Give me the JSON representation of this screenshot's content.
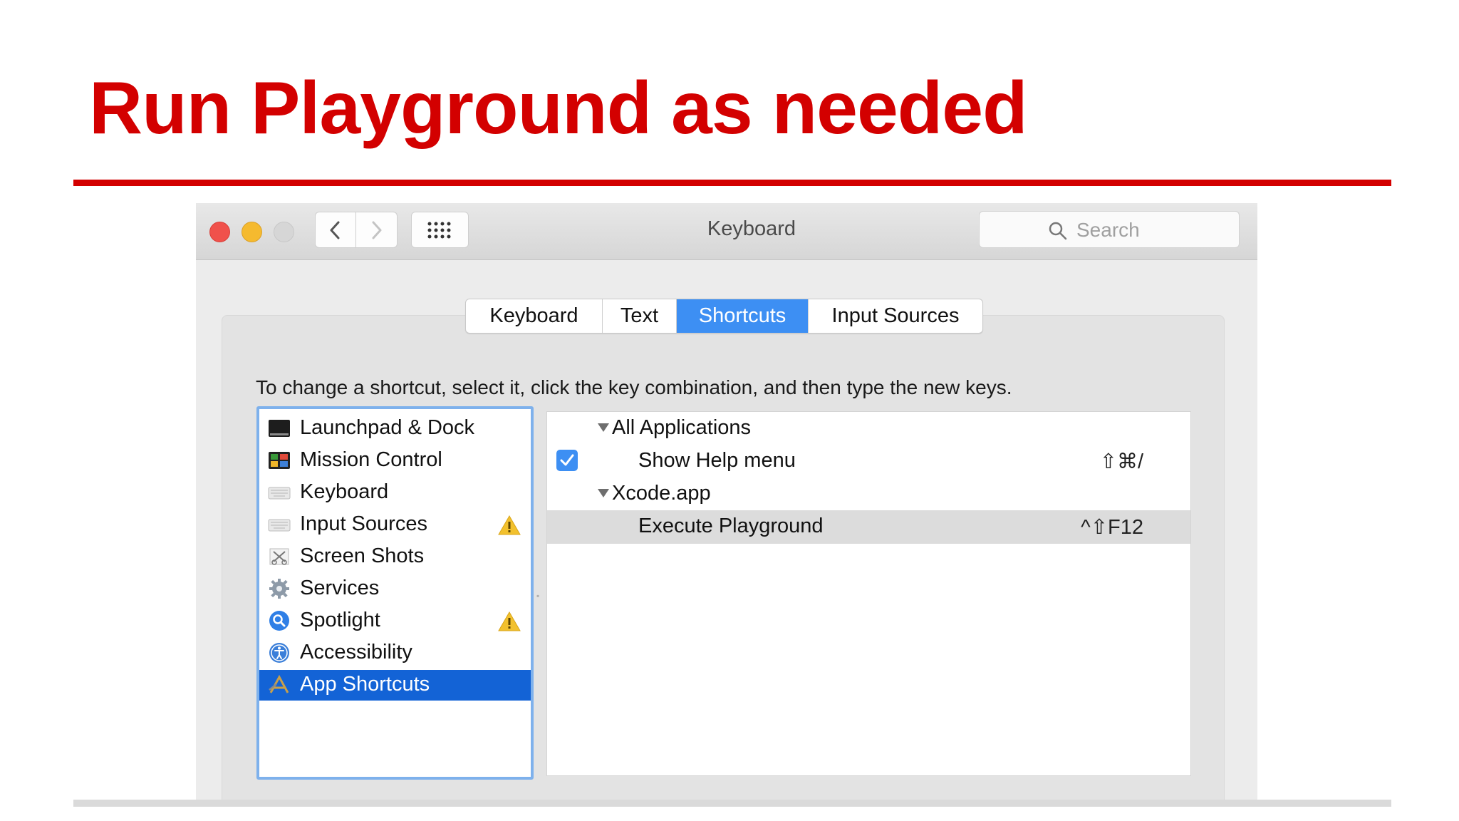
{
  "slide": {
    "title": "Run Playground as needed"
  },
  "window": {
    "title": "Keyboard",
    "search_placeholder": "Search"
  },
  "tabs": [
    {
      "label": "Keyboard",
      "active": false
    },
    {
      "label": "Text",
      "active": false
    },
    {
      "label": "Shortcuts",
      "active": true
    },
    {
      "label": "Input Sources",
      "active": false
    }
  ],
  "instruction": "To change a shortcut, select it, click the key combination, and then type the new keys.",
  "categories": [
    {
      "label": "Launchpad & Dock",
      "icon": "launchpad-dock-icon",
      "warning": false,
      "selected": false
    },
    {
      "label": "Mission Control",
      "icon": "mission-control-icon",
      "warning": false,
      "selected": false
    },
    {
      "label": "Keyboard",
      "icon": "keyboard-icon",
      "warning": false,
      "selected": false
    },
    {
      "label": "Input Sources",
      "icon": "input-sources-icon",
      "warning": true,
      "selected": false
    },
    {
      "label": "Screen Shots",
      "icon": "screen-shots-icon",
      "warning": false,
      "selected": false
    },
    {
      "label": "Services",
      "icon": "gear-icon",
      "warning": false,
      "selected": false
    },
    {
      "label": "Spotlight",
      "icon": "spotlight-icon",
      "warning": true,
      "selected": false
    },
    {
      "label": "Accessibility",
      "icon": "accessibility-icon",
      "warning": false,
      "selected": false
    },
    {
      "label": "App Shortcuts",
      "icon": "app-shortcuts-icon",
      "warning": false,
      "selected": true
    }
  ],
  "shortcuts": {
    "groups": [
      {
        "name": "All Applications",
        "items": [
          {
            "label": "Show Help menu",
            "keys": "⇧⌘/",
            "checked": true
          }
        ]
      },
      {
        "name": "Xcode.app",
        "items": [
          {
            "label": "Execute Playground",
            "keys": "^⇧F12",
            "checked": false,
            "highlighted": true
          }
        ]
      }
    ]
  },
  "colors": {
    "title_red": "#d30000",
    "accent_blue": "#3d8ff3",
    "selection_blue": "#1363d6",
    "warning_yellow": "#f2c12e"
  }
}
